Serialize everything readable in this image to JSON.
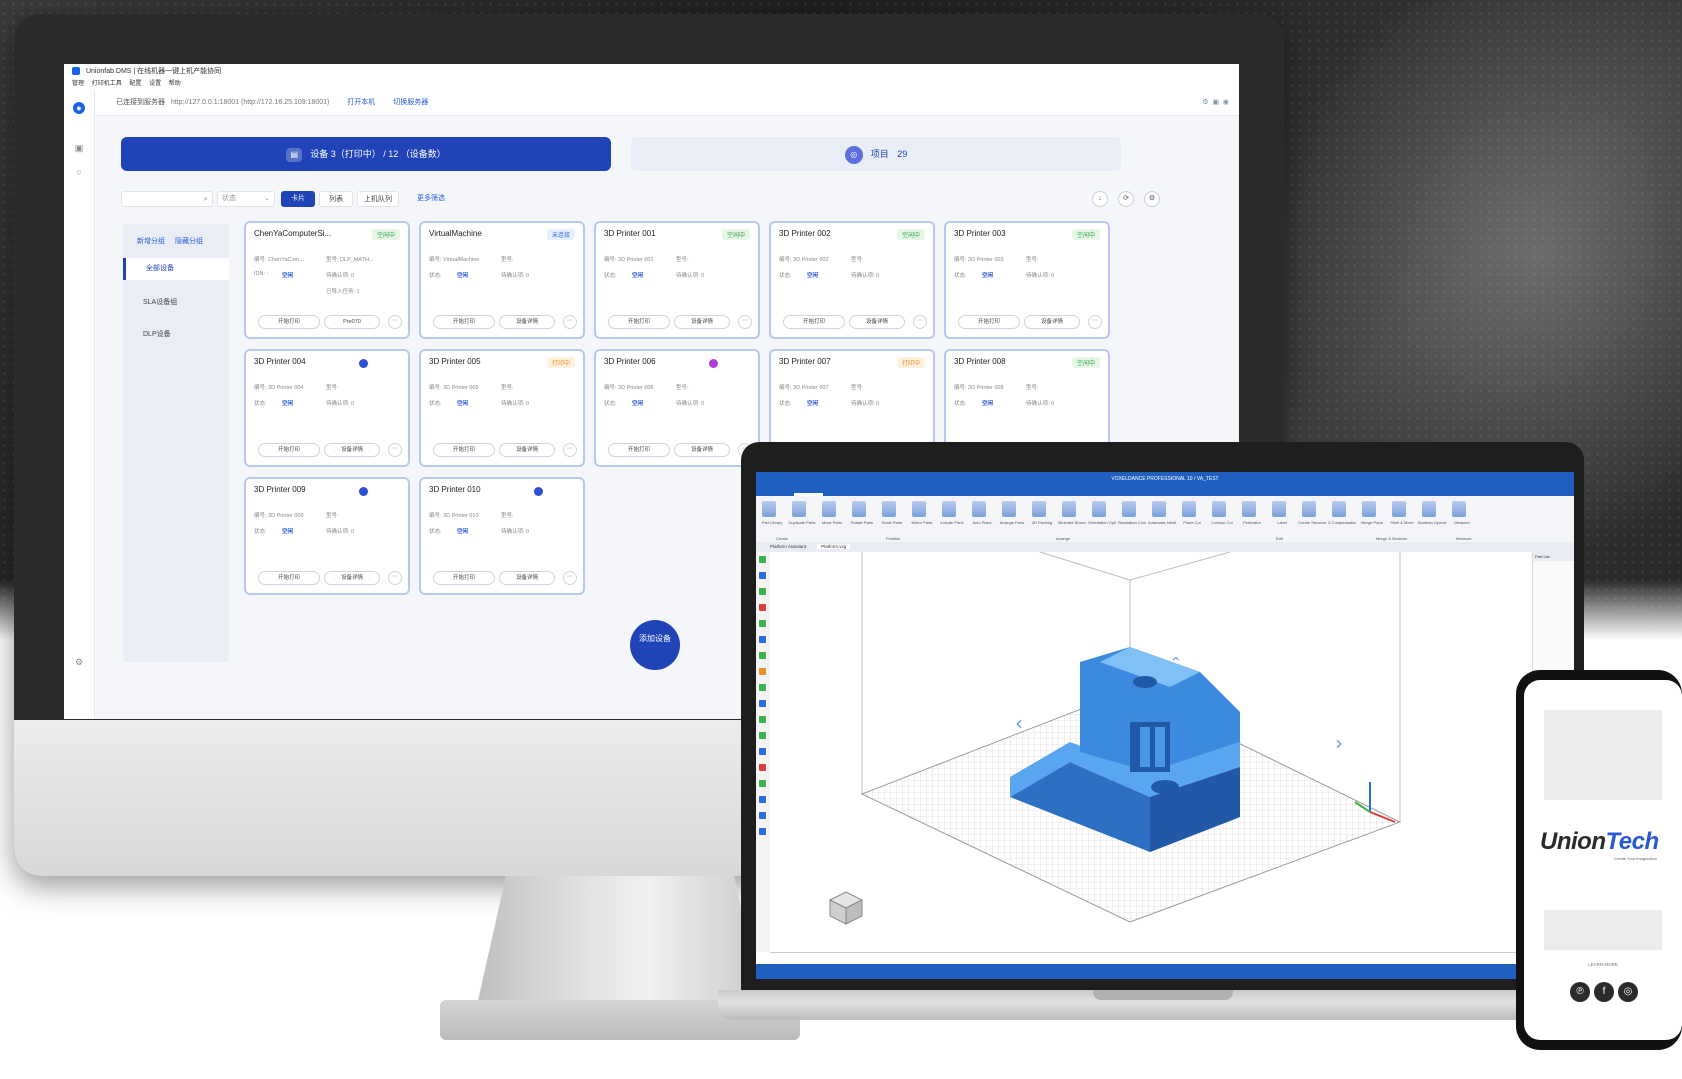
{
  "desktop_app": {
    "window_title": "Unionfab DMS | 在线机器一键上机产能协同",
    "menu": [
      "管理",
      "打印机工具",
      "配置",
      "设置",
      "帮助"
    ],
    "address": {
      "label": "已连接到服务器",
      "url": "http://127.0.0.1:18001 (http://172.16.25.109:18001)",
      "open_link": "打开本机",
      "switch_link": "切换服务器"
    },
    "tabs": {
      "devices": "设备  3（打印中） / 12 （设备数）",
      "projects": "项目",
      "projects_count": "29"
    },
    "filters": {
      "search_placeholder": "",
      "status_placeholder": "状态",
      "view_card": "卡片",
      "view_list": "列表",
      "online_label": "上机队列",
      "more_filter": "更多筛选"
    },
    "groups": {
      "add_group": "新增分组",
      "hide_group": "隐藏分组",
      "items": [
        "全部设备",
        "SLA设备组",
        "DLP设备"
      ]
    },
    "cards": [
      {
        "name": "ChenYaComputerSi...",
        "status": "空闲中",
        "status_type": "idle",
        "id_line": "编号: ChenYaCom...",
        "model_line": "型号: DLP_MATH...",
        "ip_line": "IDN: -",
        "mode_label": "状态:",
        "mode_value": "空闲",
        "queue_line": "待确认项: 0",
        "done_line": "已导入任务: 1",
        "btn1": "开始打印",
        "btn2": "Pre070"
      },
      {
        "name": "VirtualMachine",
        "status": "未连接",
        "status_type": "offline",
        "id_line": "编号: VirtualMachine",
        "model_line": "型号:",
        "ip_line": "状态:",
        "mode_label": "",
        "mode_value": "空闲",
        "queue_line": "待确认项: 0",
        "done_line": "",
        "btn1": "开始打印",
        "btn2": "设备详情"
      },
      {
        "name": "3D Printer 001",
        "status": "空闲中",
        "status_type": "idle",
        "id_line": "编号: 3D Printer 001",
        "model_line": "型号:",
        "ip_line": "状态:",
        "mode_label": "",
        "mode_value": "空闲",
        "queue_line": "待确认项: 0",
        "done_line": "",
        "btn1": "开始打印",
        "btn2": "设备详情"
      },
      {
        "name": "3D Printer 002",
        "status": "空闲中",
        "status_type": "idle",
        "id_line": "编号: 3D Printer 002",
        "model_line": "型号:",
        "ip_line": "状态:",
        "mode_label": "",
        "mode_value": "空闲",
        "queue_line": "待确认项: 0",
        "done_line": "",
        "btn1": "开始打印",
        "btn2": "设备详情"
      },
      {
        "name": "3D Printer 003",
        "status": "空闲中",
        "status_type": "idle",
        "id_line": "编号: 3D Printer 003",
        "model_line": "型号:",
        "ip_line": "状态:",
        "mode_label": "",
        "mode_value": "空闲",
        "queue_line": "待确认项: 0",
        "done_line": "",
        "btn1": "开始打印",
        "btn2": "设备详情"
      },
      {
        "name": "3D Printer 004",
        "status": "",
        "status_type": "dot-blue",
        "id_line": "编号: 3D Printer 004",
        "model_line": "型号:",
        "ip_line": "状态:",
        "mode_label": "",
        "mode_value": "空闲",
        "queue_line": "待确认项: 0",
        "done_line": "",
        "btn1": "开始打印",
        "btn2": "设备详情"
      },
      {
        "name": "3D Printer 005",
        "status": "打印中",
        "status_type": "busy",
        "id_line": "编号: 3D Printer 005",
        "model_line": "型号:",
        "ip_line": "状态:",
        "mode_label": "",
        "mode_value": "空闲",
        "queue_line": "待确认项: 0",
        "done_line": "",
        "btn1": "开始打印",
        "btn2": "设备详情"
      },
      {
        "name": "3D Printer 006",
        "status": "",
        "status_type": "dot-purple",
        "id_line": "编号: 3D Printer 006",
        "model_line": "型号:",
        "ip_line": "状态:",
        "mode_label": "",
        "mode_value": "空闲",
        "queue_line": "待确认项: 0",
        "done_line": "",
        "btn1": "开始打印",
        "btn2": "设备详情"
      },
      {
        "name": "3D Printer 007",
        "status": "打印中",
        "status_type": "busy",
        "id_line": "编号: 3D Printer 007",
        "model_line": "型号:",
        "ip_line": "状态:",
        "mode_label": "",
        "mode_value": "空闲",
        "queue_line": "待确认项: 0",
        "done_line": "",
        "btn1": "开始打印",
        "btn2": "设备详情"
      },
      {
        "name": "3D Printer 008",
        "status": "空闲中",
        "status_type": "idle",
        "id_line": "编号: 3D Printer 008",
        "model_line": "型号:",
        "ip_line": "状态:",
        "mode_label": "",
        "mode_value": "空闲",
        "queue_line": "待确认项: 0",
        "done_line": "",
        "btn1": "开始打印",
        "btn2": "设备详情"
      },
      {
        "name": "3D Printer 009",
        "status": "",
        "status_type": "dot-blue",
        "id_line": "编号: 3D Printer 009",
        "model_line": "型号:",
        "ip_line": "状态:",
        "mode_label": "",
        "mode_value": "空闲",
        "queue_line": "待确认项: 0",
        "done_line": "",
        "btn1": "开始打印",
        "btn2": "设备详情"
      },
      {
        "name": "3D Printer 010",
        "status": "",
        "status_type": "dot-blue",
        "id_line": "编号: 3D Printer 010",
        "model_line": "型号:",
        "ip_line": "状态:",
        "mode_label": "",
        "mode_value": "空闲",
        "queue_line": "待确认项: 0",
        "done_line": "",
        "btn1": "开始打印",
        "btn2": "设备详情"
      }
    ],
    "add_device": "添加设备"
  },
  "laptop_app": {
    "title": "VOXELDANCE PROFESSIONAL 10 / VA_TEST",
    "tabs": [
      "HOME",
      "PREPARE",
      "REPAIR",
      "SUPPORT",
      "QUALITY & REPORT",
      "SLICING",
      "BUILD",
      "VIEW",
      "SETTINGS & HELP"
    ],
    "active_tab": "PREPARE",
    "ribbon_groups": [
      "Create",
      "Position",
      "Arrange",
      "Edit",
      "Merge & Boolean",
      "Measure"
    ],
    "ribbon_buttons": [
      "Part Library",
      "Duplicate Parts",
      "Move Parts",
      "Rotate Parts",
      "Scale Parts",
      "Mirror Parts",
      "Include Parts",
      "Auto Place",
      "Arrange Parts",
      "3D Packing",
      "Minimize Bounding Box",
      "Orientation Optimizer",
      "Simulation Comparator",
      "Automatic Nesting",
      "Plane Cut",
      "Contour Cut",
      "Perforator",
      "Label",
      "Create Structure",
      "Z Compensation",
      "Merge Parts",
      "Shell & Mesh",
      "Boolean Operation",
      "Measure"
    ],
    "doc_tabs": [
      "Platform Assistant",
      "Platform.vxg"
    ],
    "right_panel_label": "Part List"
  },
  "phone": {
    "brand_main": "Union",
    "brand_accent": "Tech",
    "tagline": "Create Your Imagination",
    "learn_more": "LEARN  MORE"
  },
  "colors": {
    "primary": "#2043b8",
    "idle": "#35a24a",
    "busy": "#e8902a",
    "offline": "#2a6be6",
    "part_blue": "#3a8fe8"
  }
}
